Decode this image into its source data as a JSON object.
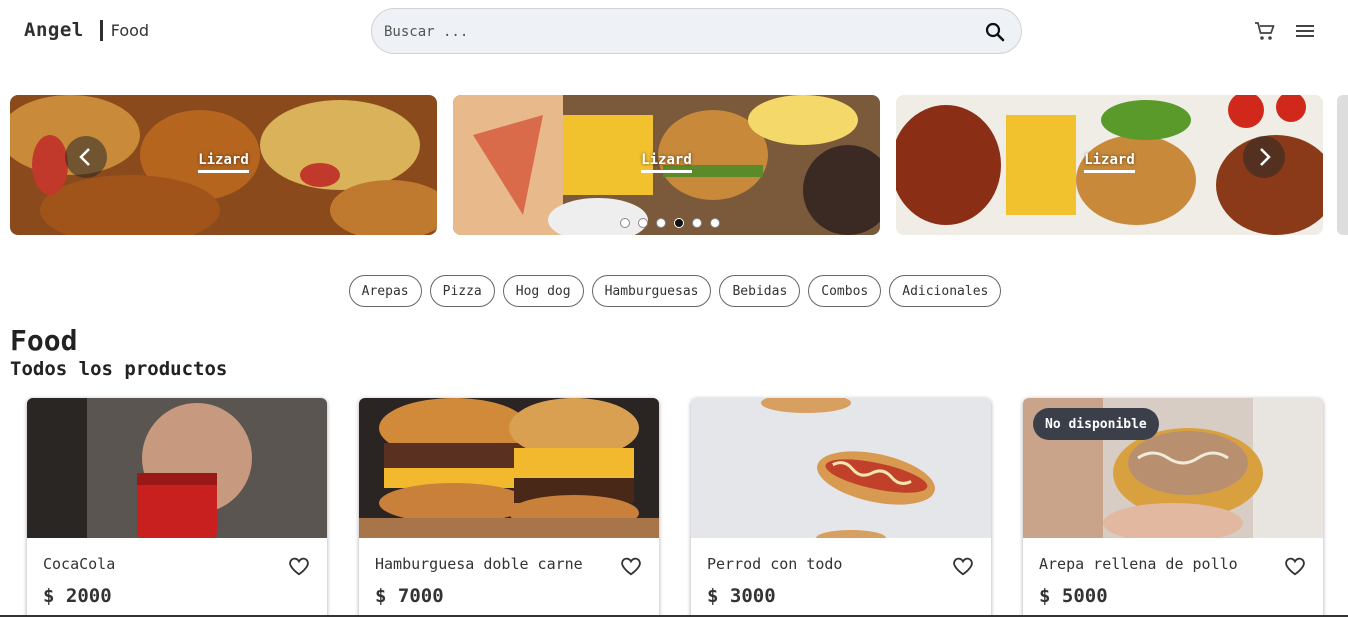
{
  "header": {
    "brand_name": "Angel",
    "brand_sub": "Food",
    "search_placeholder": "Buscar ...",
    "icons": {
      "search": "search-icon",
      "cart": "cart-icon",
      "menu": "menu-icon"
    }
  },
  "carousel": {
    "slides": [
      {
        "caption": "Lizard"
      },
      {
        "caption": "Lizard"
      },
      {
        "caption": "Lizard"
      }
    ],
    "dots_count": 6,
    "active_dot": 4
  },
  "categories": [
    "Arepas",
    "Pizza",
    "Hog dog",
    "Hamburguesas",
    "Bebidas",
    "Combos",
    "Adicionales"
  ],
  "section": {
    "title": "Food",
    "subtitle": "Todos los productos"
  },
  "products": [
    {
      "name": "CocaCola",
      "price": "$ 2000",
      "badge": ""
    },
    {
      "name": "Hamburguesa doble carne",
      "price": "$ 7000",
      "badge": ""
    },
    {
      "name": "Perrod con todo",
      "price": "$ 3000",
      "badge": ""
    },
    {
      "name": "Arepa rellena de pollo",
      "price": "$ 5000",
      "badge": "No disponible"
    }
  ],
  "colors": {
    "search_bg": "#eef1f5",
    "badge_bg": "#3a3f4a",
    "text": "#333333"
  }
}
